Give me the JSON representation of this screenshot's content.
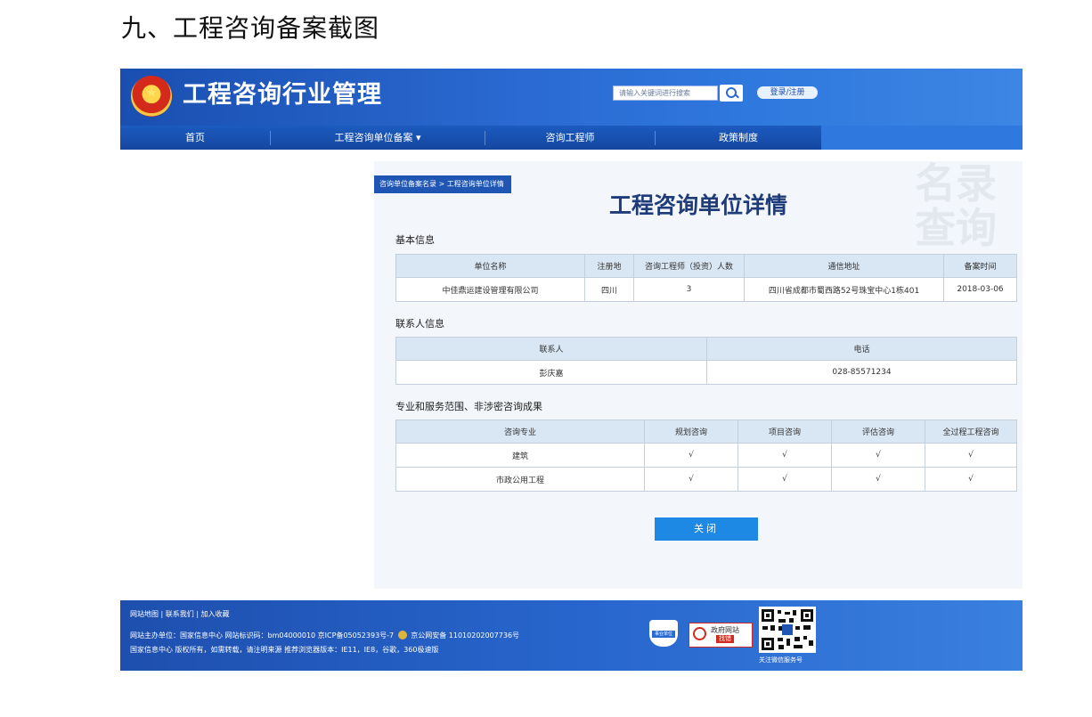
{
  "doc_heading": "九、工程咨询备案截图",
  "header": {
    "site_title": "工程咨询行业管理",
    "search_placeholder": "请输入关键词进行搜索",
    "login_label": "登录/注册"
  },
  "nav": {
    "items": [
      {
        "label": "首页"
      },
      {
        "label": "工程咨询单位备案 ▾"
      },
      {
        "label": "咨询工程师"
      },
      {
        "label": "政策制度"
      }
    ]
  },
  "panel": {
    "breadcrumb": "咨询单位备案名录 > 工程咨询单位详情",
    "watermark": "名录查询",
    "title": "工程咨询单位详情",
    "basic_info": {
      "title": "基本信息",
      "headers": [
        "单位名称",
        "注册地",
        "咨询工程师（投资）人数",
        "通信地址",
        "备案时间"
      ],
      "row": [
        "中佳鼎运建设管理有限公司",
        "四川",
        "3",
        "四川省成都市蜀西路52号珠宝中心1栋401",
        "2018-03-06"
      ]
    },
    "contact_info": {
      "title": "联系人信息",
      "headers": [
        "联系人",
        "电话"
      ],
      "row": [
        "彭庆嘉",
        "028-85571234"
      ]
    },
    "scope_info": {
      "title": "专业和服务范围、非涉密咨询成果",
      "headers": [
        "咨询专业",
        "规划咨询",
        "项目咨询",
        "评估咨询",
        "全过程工程咨询"
      ],
      "rows": [
        [
          "建筑",
          "√",
          "√",
          "√",
          "√"
        ],
        [
          "市政公用工程",
          "√",
          "√",
          "√",
          "√"
        ]
      ]
    },
    "close_label": "关闭"
  },
  "footer": {
    "links": "网站地图 | 联系我们 | 加入收藏",
    "line1_a": "网站主办单位：国家信息中心   网站标识码：bm04000010   京ICP备05052393号-7",
    "line1_b": "京公网安备 11010202007736号",
    "line2": "国家信息中心 版权所有，如需转载，请注明来源   推荐浏览器版本：IE11，IE8，谷歌，360极速版",
    "shield_text": "事业单位",
    "gov_badge_line1": "政府网站",
    "gov_badge_line2": "找错",
    "qr_caption": "关注微信服务号"
  }
}
